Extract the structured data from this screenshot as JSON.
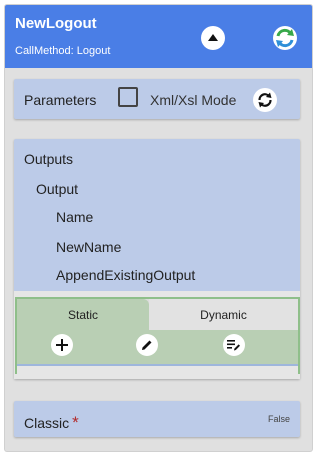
{
  "header": {
    "title": "NewLogout",
    "subtitle": "CallMethod: Logout"
  },
  "parameters": {
    "label": "Parameters",
    "xml_mode_label": "Xml/Xsl Mode",
    "xml_mode_checked": false
  },
  "outputs": {
    "label": "Outputs",
    "items": [
      {
        "label": "Output",
        "level": 1
      },
      {
        "label": "Name",
        "level": 2
      },
      {
        "label": "NewName",
        "level": 2
      },
      {
        "label": "AppendExistingOutput",
        "level": 2
      }
    ],
    "tabs": [
      {
        "label": "Static",
        "active": true
      },
      {
        "label": "Dynamic",
        "active": false
      }
    ]
  },
  "classic": {
    "label": "Classic",
    "required_mark": "*",
    "value": "False"
  },
  "colors": {
    "header_bg": "#4a7ee6",
    "card_bg": "#bccbe8",
    "static_tab_bg": "#b9cfb4",
    "required": "#b22a2a"
  }
}
